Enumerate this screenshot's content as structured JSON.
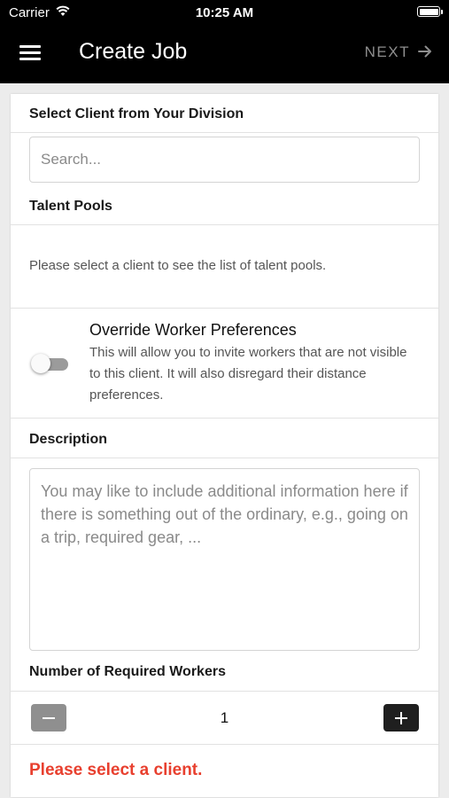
{
  "status_bar": {
    "carrier": "Carrier",
    "time": "10:25 AM",
    "battery_level": 1.0
  },
  "nav": {
    "title": "Create Job",
    "next_label": "NEXT",
    "icons": {
      "menu": "hamburger-menu-icon",
      "next": "arrow-right-icon"
    }
  },
  "client": {
    "label": "Select Client from Your Division",
    "search_placeholder": "Search...",
    "search_value": ""
  },
  "talent_pools": {
    "label": "Talent Pools",
    "message": "Please select a client to see the list of talent pools."
  },
  "override": {
    "title": "Override Worker Preferences",
    "description": "This will allow you to invite workers that are not visible to this client. It will also disregard their distance preferences.",
    "enabled": false
  },
  "description": {
    "label": "Description",
    "placeholder": "You may like to include additional information here if there is something out of the ordinary, e.g., going on a trip, required gear, ...",
    "value": ""
  },
  "workers": {
    "label": "Number of Required Workers",
    "count": "1"
  },
  "error": {
    "message": "Please select a client.",
    "color": "#e8402f"
  },
  "colors": {
    "header_bg": "#000000",
    "page_bg": "#ececec",
    "minus_button": "#8f8f8f",
    "plus_button": "#1f1f1f"
  }
}
